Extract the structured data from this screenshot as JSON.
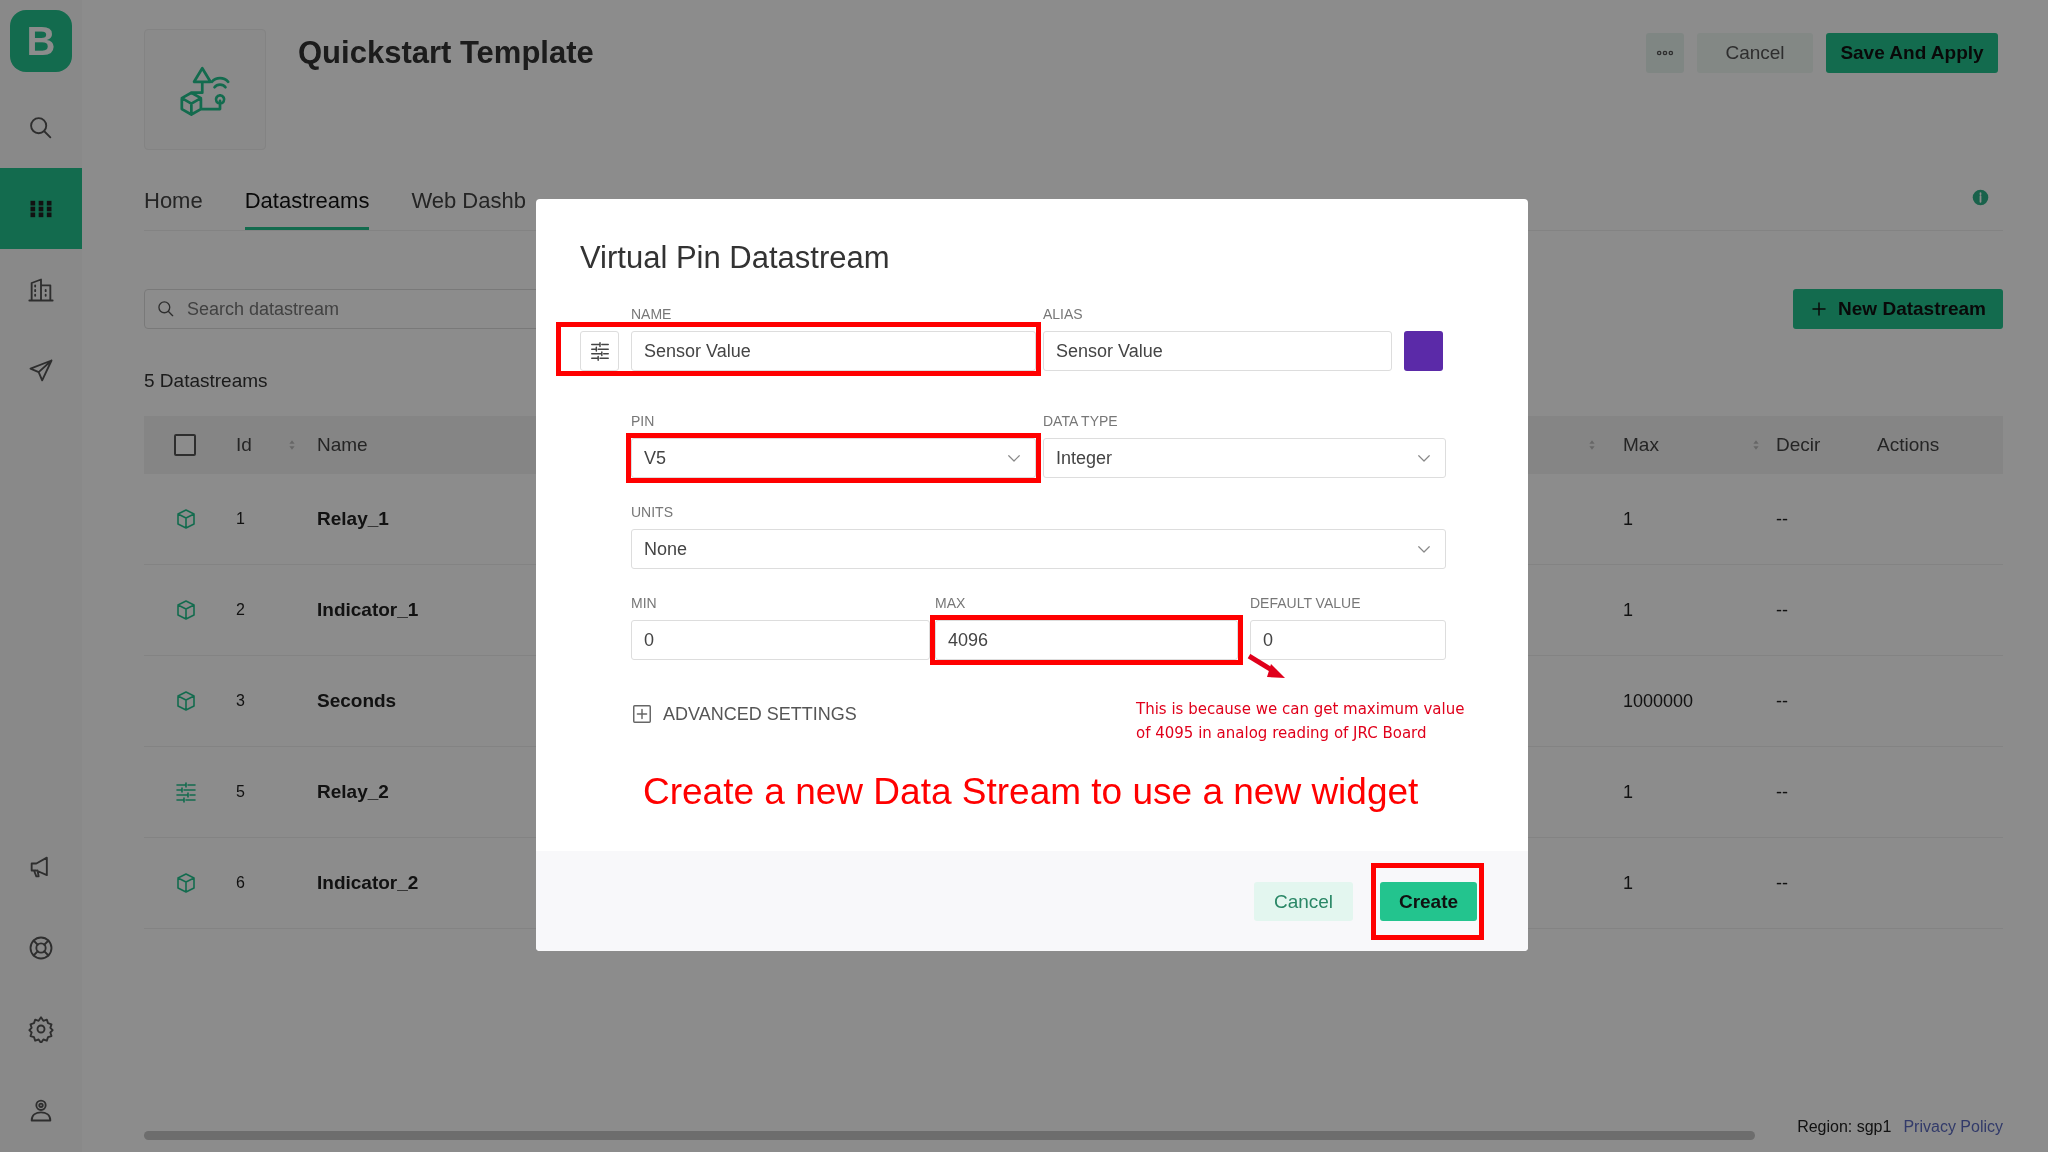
{
  "sidebar": {
    "logo": "B",
    "top_items": [
      {
        "kind": "search",
        "selected": false
      },
      {
        "kind": "grid",
        "selected": true
      },
      {
        "kind": "building",
        "selected": false
      },
      {
        "kind": "send",
        "selected": false
      }
    ],
    "bottom_items": [
      {
        "kind": "megaphone",
        "selected": false
      },
      {
        "kind": "lifebuoy",
        "selected": false
      },
      {
        "kind": "gear",
        "selected": false
      },
      {
        "kind": "user",
        "selected": false
      }
    ]
  },
  "header": {
    "title": "Quickstart Template",
    "buttons": [
      {
        "kind": "more"
      },
      {
        "kind": "secondary",
        "label": "Cancel"
      },
      {
        "kind": "primary",
        "label": "Save And Apply"
      }
    ]
  },
  "tabs": [
    {
      "label": "Home",
      "selected": false
    },
    {
      "label": "Datastreams",
      "selected": true
    },
    {
      "label": "Web Dashb",
      "selected": false
    }
  ],
  "search": {
    "placeholder": "Search datastream"
  },
  "new_button": {
    "label": "New Datastream"
  },
  "count": "5 Datastreams",
  "table": {
    "select_all_checked": false,
    "columns": [
      "Id",
      "Name",
      "Max",
      "Decir",
      "Actions"
    ],
    "rows": [
      {
        "kind": "cube",
        "id": "1",
        "name": "Relay_1",
        "max": "1",
        "decimal": "--"
      },
      {
        "kind": "cube",
        "id": "2",
        "name": "Indicator_1",
        "max": "1",
        "decimal": "--"
      },
      {
        "kind": "cube",
        "id": "3",
        "name": "Seconds",
        "max": "1000000",
        "decimal": "--"
      },
      {
        "kind": "sliders",
        "id": "5",
        "name": "Relay_2",
        "max": "1",
        "decimal": "--"
      },
      {
        "kind": "cube",
        "id": "6",
        "name": "Indicator_2",
        "max": "1",
        "decimal": "--"
      }
    ]
  },
  "modal": {
    "title": "Virtual Pin Datastream",
    "name": {
      "label": "NAME",
      "value": "Sensor Value",
      "highlighted": true
    },
    "alias": {
      "label": "ALIAS",
      "value": "Sensor Value",
      "color": "#5b2aa8"
    },
    "pin": {
      "label": "PIN",
      "value": "V5",
      "highlighted": true
    },
    "data_type": {
      "label": "DATA TYPE",
      "value": "Integer",
      "highlighted": false
    },
    "units": {
      "label": "UNITS",
      "value": "None",
      "highlighted": false
    },
    "min": {
      "label": "MIN",
      "value": "0",
      "highlighted": false
    },
    "max": {
      "label": "MAX",
      "value": "4096",
      "highlighted": true
    },
    "default_value": {
      "label": "DEFAULT VALUE",
      "value": "0",
      "highlighted": false
    },
    "advanced": {
      "label": "ADVANCED SETTINGS",
      "expanded": false
    },
    "note": "This is because we can get maximum value of 4095 in analog reading of JRC Board",
    "caption": "Create a new Data Stream to use a new widget",
    "buttons": [
      {
        "kind": "secondary",
        "label": "Cancel",
        "highlighted": false
      },
      {
        "kind": "primary",
        "label": "Create",
        "highlighted": true
      }
    ]
  },
  "footer": {
    "region": "Region: sgp1",
    "link": "Privacy Policy"
  }
}
